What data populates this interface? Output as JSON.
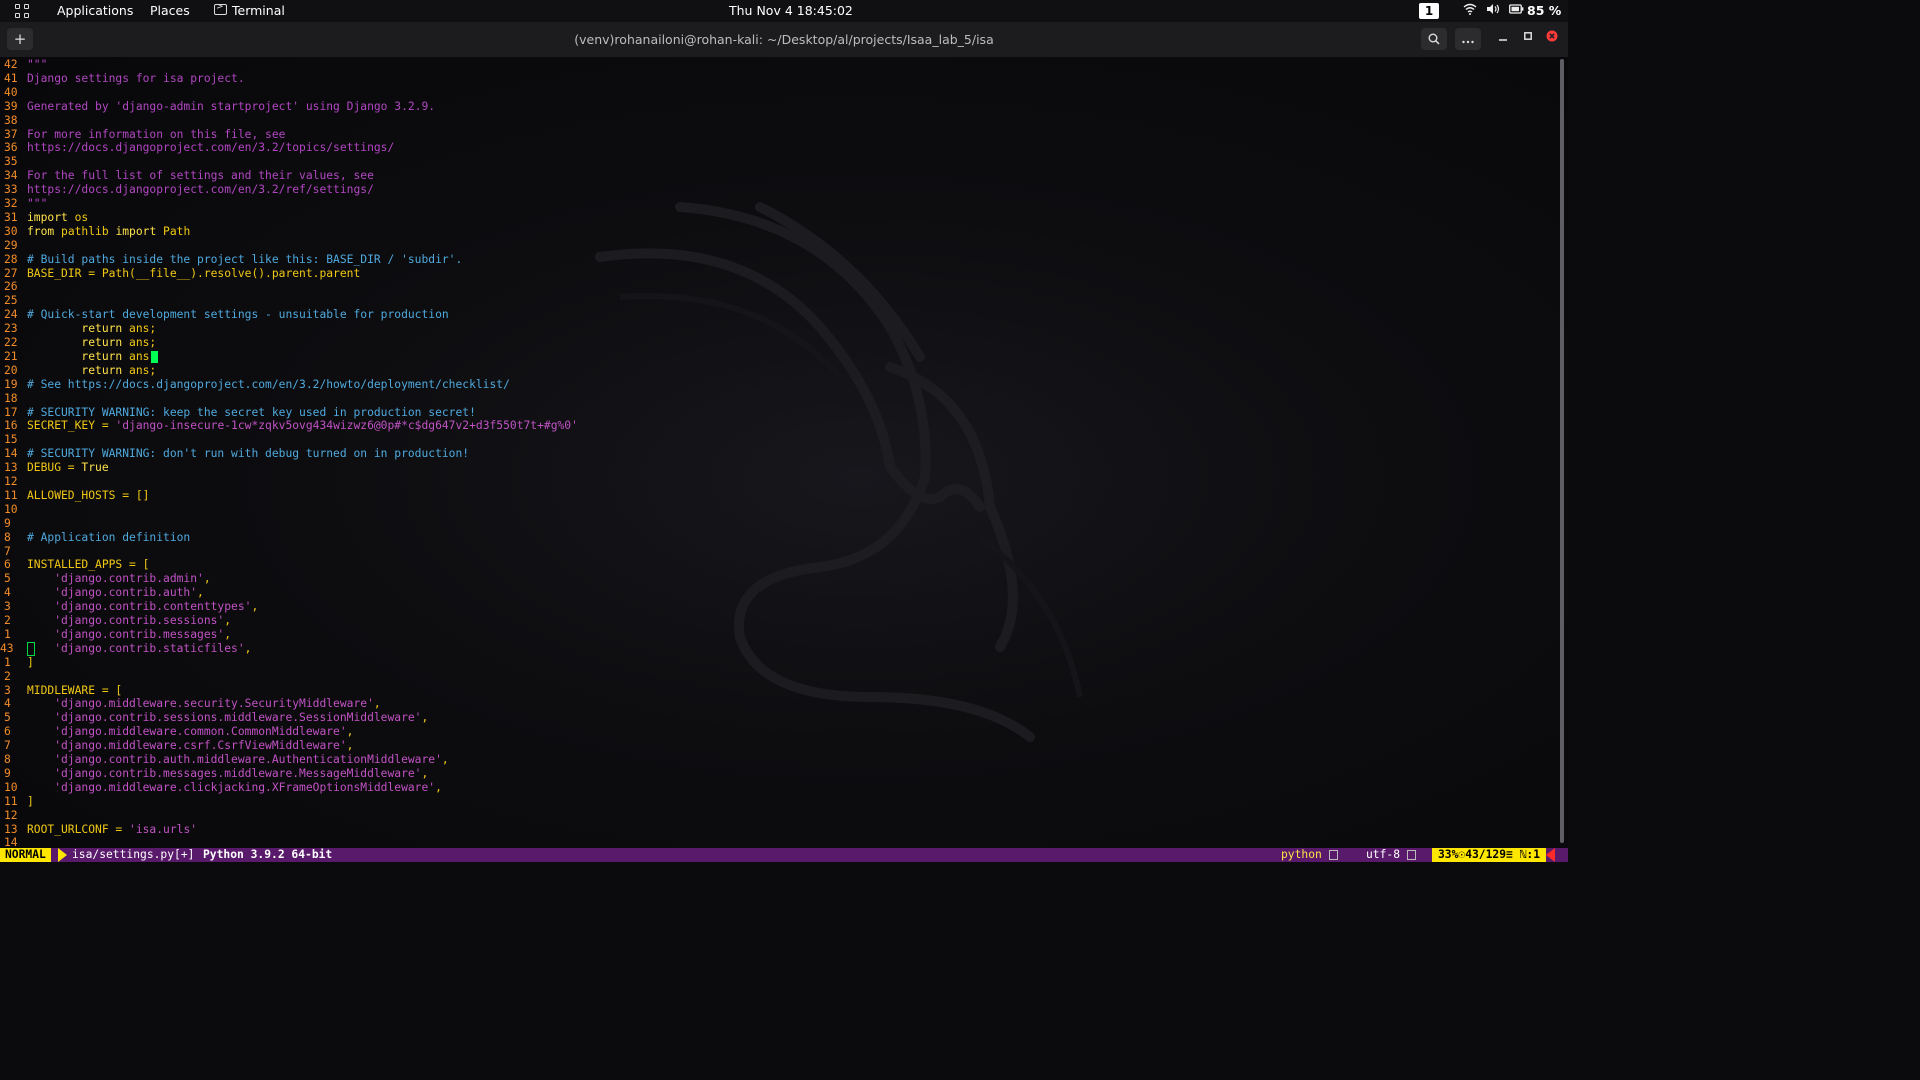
{
  "topbar": {
    "applications": "Applications",
    "places": "Places",
    "terminal": "Terminal",
    "datetime": "Thu Nov 4  18:45:02",
    "workspace": "1",
    "battery": "85 %"
  },
  "window": {
    "title": "(venv)rohanailoni@rohan-kali: ~/Desktop/al/projects/Isaa_lab_5/isa",
    "new_tab": "+"
  },
  "editor": {
    "lines": [
      {
        "ln": "42",
        "code": [
          {
            "t": "\"\"\"",
            "c": "doc"
          }
        ]
      },
      {
        "ln": "41",
        "code": [
          {
            "t": "Django settings for isa project.",
            "c": "doc"
          }
        ]
      },
      {
        "ln": "40",
        "code": []
      },
      {
        "ln": "39",
        "code": [
          {
            "t": "Generated by 'django-admin startproject' using Django 3.2.9.",
            "c": "doc"
          }
        ]
      },
      {
        "ln": "38",
        "code": []
      },
      {
        "ln": "37",
        "code": [
          {
            "t": "For more information on this file, see",
            "c": "doc"
          }
        ]
      },
      {
        "ln": "36",
        "code": [
          {
            "t": "https://docs.djangoproject.com/en/3.2/topics/settings/",
            "c": "doc"
          }
        ]
      },
      {
        "ln": "35",
        "code": []
      },
      {
        "ln": "34",
        "code": [
          {
            "t": "For the full list of settings and their values, see",
            "c": "doc"
          }
        ]
      },
      {
        "ln": "33",
        "code": [
          {
            "t": "https://docs.djangoproject.com/en/3.2/ref/settings/",
            "c": "doc"
          }
        ]
      },
      {
        "ln": "32",
        "code": [
          {
            "t": "\"\"\"",
            "c": "doc"
          }
        ]
      },
      {
        "ln": "31",
        "code": [
          {
            "t": "import",
            "c": "kw"
          },
          {
            "t": " os",
            "c": "id"
          }
        ]
      },
      {
        "ln": "30",
        "code": [
          {
            "t": "from",
            "c": "kw"
          },
          {
            "t": " pathlib ",
            "c": "id"
          },
          {
            "t": "import",
            "c": "kw"
          },
          {
            "t": " Path",
            "c": "id"
          }
        ]
      },
      {
        "ln": "29",
        "code": []
      },
      {
        "ln": "28",
        "code": [
          {
            "t": "# Build paths inside the project like this: BASE_DIR / 'subdir'.",
            "c": "com"
          }
        ]
      },
      {
        "ln": "27",
        "code": [
          {
            "t": "BASE_DIR = Path(__file__).resolve().parent.parent",
            "c": "id"
          }
        ]
      },
      {
        "ln": "26",
        "code": []
      },
      {
        "ln": "25",
        "code": []
      },
      {
        "ln": "24",
        "code": [
          {
            "t": "# Quick-start development settings - unsuitable for production",
            "c": "com"
          }
        ]
      },
      {
        "ln": "23",
        "code": [
          {
            "t": "        return",
            "c": "kw"
          },
          {
            "t": " ans;",
            "c": "id"
          }
        ]
      },
      {
        "ln": "22",
        "code": [
          {
            "t": "        return",
            "c": "kw"
          },
          {
            "t": " ans;",
            "c": "id"
          }
        ]
      },
      {
        "ln": "21",
        "code": [
          {
            "t": "        return",
            "c": "kw"
          },
          {
            "t": " ans;",
            "c": "id"
          }
        ]
      },
      {
        "ln": "20",
        "code": [
          {
            "t": "        return",
            "c": "kw"
          },
          {
            "t": " ans;",
            "c": "id"
          }
        ]
      },
      {
        "ln": "19",
        "code": [
          {
            "t": "# See https://docs.djangoproject.com/en/3.2/howto/deployment/checklist/",
            "c": "com"
          }
        ]
      },
      {
        "ln": "18",
        "code": []
      },
      {
        "ln": "17",
        "code": [
          {
            "t": "# SECURITY WARNING: keep the secret key used in production secret!",
            "c": "com"
          }
        ]
      },
      {
        "ln": "16",
        "code": [
          {
            "t": "SECRET_KEY = ",
            "c": "id"
          },
          {
            "t": "'django-insecure-1cw*zqkv5ovg434wizwz6@0p#*c$dg647v2+d3f550t7t+#g%0'",
            "c": "str"
          }
        ]
      },
      {
        "ln": "15",
        "code": []
      },
      {
        "ln": "14",
        "code": [
          {
            "t": "# SECURITY WARNING: don't run with debug turned on in production!",
            "c": "com"
          }
        ]
      },
      {
        "ln": "13",
        "code": [
          {
            "t": "DEBUG = ",
            "c": "id"
          },
          {
            "t": "True",
            "c": "kw"
          }
        ]
      },
      {
        "ln": "12",
        "code": []
      },
      {
        "ln": "11",
        "code": [
          {
            "t": "ALLOWED_HOSTS = []",
            "c": "id"
          }
        ]
      },
      {
        "ln": "10",
        "code": []
      },
      {
        "ln": "9",
        "code": []
      },
      {
        "ln": "8",
        "code": [
          {
            "t": "# Application definition",
            "c": "com"
          }
        ]
      },
      {
        "ln": "7",
        "code": []
      },
      {
        "ln": "6",
        "code": [
          {
            "t": "INSTALLED_APPS = [",
            "c": "id"
          }
        ]
      },
      {
        "ln": "5",
        "code": [
          {
            "t": "    'django.contrib.admin'",
            "c": "str"
          },
          {
            "t": ",",
            "c": "id"
          }
        ]
      },
      {
        "ln": "4",
        "code": [
          {
            "t": "    'django.contrib.auth'",
            "c": "str"
          },
          {
            "t": ",",
            "c": "id"
          }
        ]
      },
      {
        "ln": "3",
        "code": [
          {
            "t": "    'django.contrib.contenttypes'",
            "c": "str"
          },
          {
            "t": ",",
            "c": "id"
          }
        ]
      },
      {
        "ln": "2",
        "code": [
          {
            "t": "    'django.contrib.sessions'",
            "c": "str"
          },
          {
            "t": ",",
            "c": "id"
          }
        ]
      },
      {
        "ln": "1",
        "code": [
          {
            "t": "    'django.contrib.messages'",
            "c": "str"
          },
          {
            "t": ",",
            "c": "id"
          }
        ]
      },
      {
        "ln": "43",
        "code": [
          {
            "t": "    'django.contrib.staticfiles'",
            "c": "str"
          },
          {
            "t": ",",
            "c": "id"
          }
        ],
        "current": true
      },
      {
        "ln": "1",
        "code": [
          {
            "t": "]",
            "c": "id"
          }
        ]
      },
      {
        "ln": "2",
        "code": []
      },
      {
        "ln": "3",
        "code": [
          {
            "t": "MIDDLEWARE = [",
            "c": "id"
          }
        ]
      },
      {
        "ln": "4",
        "code": [
          {
            "t": "    'django.middleware.security.SecurityMiddleware'",
            "c": "str"
          },
          {
            "t": ",",
            "c": "id"
          }
        ]
      },
      {
        "ln": "5",
        "code": [
          {
            "t": "    'django.contrib.sessions.middleware.SessionMiddleware'",
            "c": "str"
          },
          {
            "t": ",",
            "c": "id"
          }
        ]
      },
      {
        "ln": "6",
        "code": [
          {
            "t": "    'django.middleware.common.CommonMiddleware'",
            "c": "str"
          },
          {
            "t": ",",
            "c": "id"
          }
        ]
      },
      {
        "ln": "7",
        "code": [
          {
            "t": "    'django.middleware.csrf.CsrfViewMiddleware'",
            "c": "str"
          },
          {
            "t": ",",
            "c": "id"
          }
        ]
      },
      {
        "ln": "8",
        "code": [
          {
            "t": "    'django.contrib.auth.middleware.AuthenticationMiddleware'",
            "c": "str"
          },
          {
            "t": ",",
            "c": "id"
          }
        ]
      },
      {
        "ln": "9",
        "code": [
          {
            "t": "    'django.contrib.messages.middleware.MessageMiddleware'",
            "c": "str"
          },
          {
            "t": ",",
            "c": "id"
          }
        ]
      },
      {
        "ln": "10",
        "code": [
          {
            "t": "    'django.middleware.clickjacking.XFrameOptionsMiddleware'",
            "c": "str"
          },
          {
            "t": ",",
            "c": "id"
          }
        ]
      },
      {
        "ln": "11",
        "code": [
          {
            "t": "]",
            "c": "id"
          }
        ]
      },
      {
        "ln": "12",
        "code": []
      },
      {
        "ln": "13",
        "code": [
          {
            "t": "ROOT_URLCONF = ",
            "c": "id"
          },
          {
            "t": "'isa.urls'",
            "c": "str"
          }
        ]
      },
      {
        "ln": "14",
        "code": []
      }
    ]
  },
  "statusline": {
    "mode": "NORMAL",
    "file": "isa/settings.py[+]",
    "python_version": "Python 3.9.2 64-bit",
    "filetype": "python",
    "encoding": "utf-8",
    "position": "33%☉43/129≡ ℕ:1"
  },
  "colors": {
    "line_number": "#f28c28",
    "docstring": "#b146c2",
    "comment": "#4fa9dd",
    "string": "#c152c4",
    "keyword": "#ffe24a",
    "statusline_bg": "#5a1a6b",
    "mode_bg": "#ffe700",
    "cursor": "#00ff55"
  }
}
